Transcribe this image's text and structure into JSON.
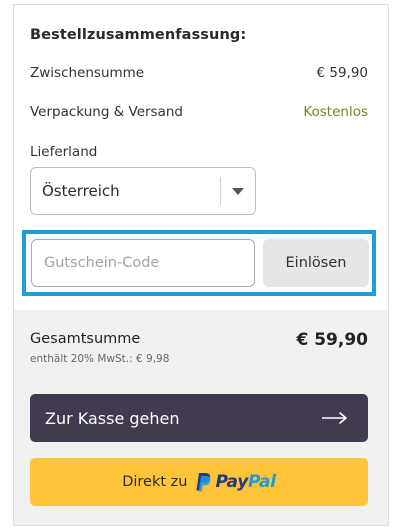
{
  "summary": {
    "title": "Bestellzusammenfassung:",
    "subtotal_label": "Zwischensumme",
    "subtotal_value": "€ 59,90",
    "shipping_label": "Verpackung & Versand",
    "shipping_value": "Kostenlos"
  },
  "country": {
    "label": "Lieferland",
    "selected": "Österreich"
  },
  "coupon": {
    "placeholder": "Gutschein-Code",
    "value": "",
    "redeem_label": "Einlösen"
  },
  "total": {
    "label": "Gesamtsumme",
    "value": "€ 59,90",
    "vat_note": "enthält 20% MwSt.: € 9,98"
  },
  "actions": {
    "checkout_label": "Zur Kasse gehen",
    "paypal_prefix": "Direkt zu",
    "paypal_word_1": "Pay",
    "paypal_word_2": "Pal"
  },
  "icons": {
    "dropdown": "chevron-down-icon",
    "checkout_arrow": "arrow-right-icon",
    "paypal": "paypal-logo-icon"
  },
  "colors": {
    "free_shipping": "#6d8a2c",
    "highlight_border": "#1b9fd6",
    "checkout_bg": "#413a50",
    "paypal_bg": "#ffc43a",
    "paypal_dark": "#233a83",
    "paypal_light": "#1f9bd8"
  }
}
